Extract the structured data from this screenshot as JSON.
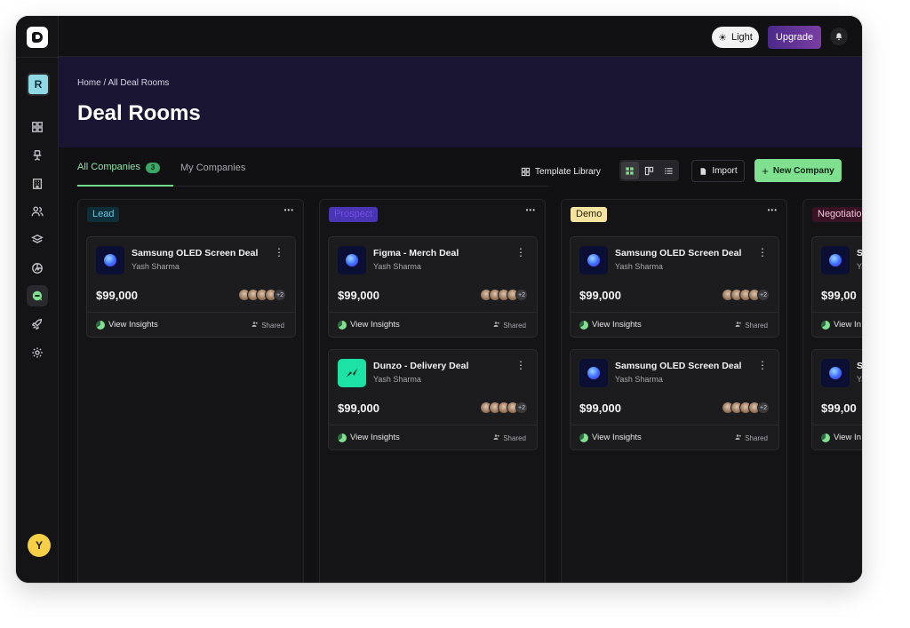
{
  "topbar": {
    "theme_label": "Light",
    "upgrade_label": "Upgrade"
  },
  "sidebar": {
    "workspace_initial": "R",
    "user_initial": "Y",
    "nav_icons": [
      "dashboard-icon",
      "chair-icon",
      "building-icon",
      "users-icon",
      "layers-icon",
      "chart-icon",
      "deal-rooms-icon",
      "rocket-icon",
      "settings-icon"
    ]
  },
  "breadcrumb": {
    "home": "Home",
    "separator": "/",
    "current": "All Deal Rooms"
  },
  "page_title": "Deal Rooms",
  "tabs": {
    "all_label": "All Companies",
    "all_count": "3",
    "my_label": "My Companies"
  },
  "toolbar": {
    "template_library": "Template Library",
    "import": "Import",
    "new_company": "New Company"
  },
  "columns": [
    {
      "label": "Lead",
      "color": "#5ec8e8",
      "bg": "#0e2f3a",
      "cards": [
        {
          "name": "Samsung OLED Screen Deal",
          "owner": "Yash Sharma",
          "amount": "$99,000",
          "more": "+2",
          "insights": "View Insights",
          "shared": "Shared",
          "logo": "samsung"
        }
      ]
    },
    {
      "label": "Prospect",
      "color": "#6f4fe0",
      "bg": "#4a35b5",
      "cards": [
        {
          "name": "Figma - Merch Deal",
          "owner": "Yash Sharma",
          "amount": "$99,000",
          "more": "+2",
          "insights": "View Insights",
          "shared": "Shared",
          "logo": "samsung"
        },
        {
          "name": "Dunzo - Delivery Deal",
          "owner": "Yash Sharma",
          "amount": "$99,000",
          "more": "+2",
          "insights": "View Insights",
          "shared": "Shared",
          "logo": "dunzo"
        }
      ]
    },
    {
      "label": "Demo",
      "color": "#2a2206",
      "bg": "#f5e3a0",
      "cards": [
        {
          "name": "Samsung OLED Screen Deal",
          "owner": "Yash Sharma",
          "amount": "$99,000",
          "more": "+2",
          "insights": "View Insights",
          "shared": "Shared",
          "logo": "samsung"
        },
        {
          "name": "Samsung OLED Screen Deal",
          "owner": "Yash Sharma",
          "amount": "$99,000",
          "more": "+2",
          "insights": "View Insights",
          "shared": "Shared",
          "logo": "samsung"
        }
      ]
    },
    {
      "label": "Negotiatio",
      "color": "#f0c4d8",
      "bg": "#3a1226",
      "cards": [
        {
          "name": "Sa",
          "owner": "Ya",
          "amount": "$99,00",
          "more": "",
          "insights": "View In",
          "shared": "",
          "logo": "samsung"
        },
        {
          "name": "Sa",
          "owner": "Ya",
          "amount": "$99,00",
          "more": "",
          "insights": "View In",
          "shared": "",
          "logo": "samsung"
        }
      ]
    }
  ]
}
